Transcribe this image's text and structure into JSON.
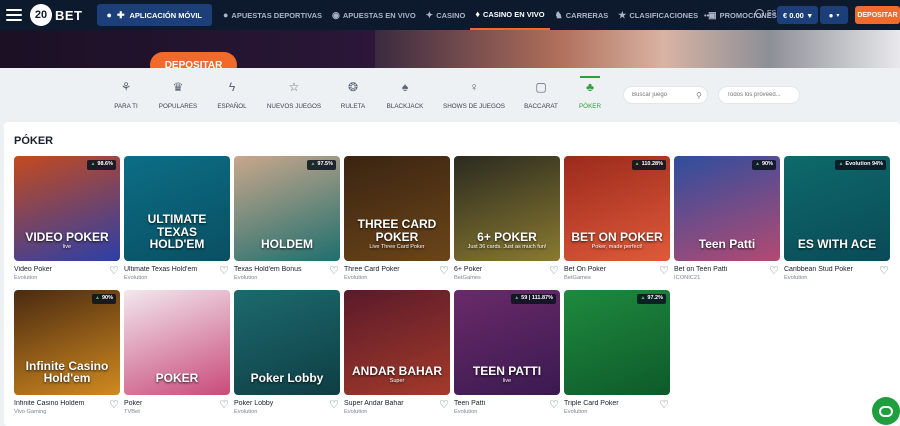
{
  "header": {
    "logo_number": "20",
    "logo_text": "BET",
    "app_button": "APLICACIÓN MÓVIL",
    "nav": [
      {
        "label": "APUESTAS DEPORTIVAS",
        "icon": "football-icon"
      },
      {
        "label": "APUESTAS EN VIVO",
        "icon": "live-icon"
      },
      {
        "label": "CASINO",
        "icon": "chip-icon"
      },
      {
        "label": "CASINO EN VIVO",
        "icon": "live-casino-icon",
        "active": true
      },
      {
        "label": "CARRERAS",
        "icon": "horse-icon"
      },
      {
        "label": "CLASIFICACIONES",
        "icon": "trophy-icon"
      },
      {
        "label": "PROMOCIONES",
        "icon": "gift-icon"
      }
    ],
    "more": "•••",
    "language": "ES",
    "balance": "€ 0.00",
    "deposit_button": "DEPOSITAR"
  },
  "banner": {
    "deposit_button": "DEPOSITAR"
  },
  "categories": [
    {
      "label": "PARA TI",
      "icon": "star-person-icon"
    },
    {
      "label": "POPULARES",
      "icon": "crown-icon"
    },
    {
      "label": "ESPAÑOL",
      "icon": "lightning-icon"
    },
    {
      "label": "NUEVOS JUEGOS",
      "icon": "star-icon"
    },
    {
      "label": "RULETA",
      "icon": "roulette-icon"
    },
    {
      "label": "BLACKJACK",
      "icon": "cards-icon"
    },
    {
      "label": "SHOWS DE JUEGOS",
      "icon": "microphone-icon"
    },
    {
      "label": "BACCARAT",
      "icon": "card-icon"
    },
    {
      "label": "PÓKER",
      "icon": "poker-icon",
      "active": true
    }
  ],
  "search": {
    "placeholder": "Buscar juego",
    "provider_placeholder": "Todos los proveed..."
  },
  "section": {
    "title": "PÓKER"
  },
  "games": [
    {
      "name": "Video Poker",
      "provider": "Evolution",
      "badge": "98.6%",
      "art_title": "VIDEO POKER",
      "art_sub": "live",
      "colors": [
        "#c44a1e",
        "#2b3fa8"
      ]
    },
    {
      "name": "Ultimate Texas Hold'em",
      "provider": "Evolution",
      "badge": "",
      "art_title": "ULTIMATE TEXAS HOLD'EM",
      "art_sub": "",
      "colors": [
        "#0b6e86",
        "#0a4f62"
      ]
    },
    {
      "name": "Texas Hold'em Bonus",
      "provider": "Evolution",
      "badge": "97.5%",
      "art_title": "HOLDEM",
      "art_sub": "",
      "colors": [
        "#c9a78c",
        "#1f6f6e"
      ]
    },
    {
      "name": "Three Card Poker",
      "provider": "Evolution",
      "badge": "",
      "art_title": "THREE CARD POKER",
      "art_sub": "Live Three Card Poker",
      "colors": [
        "#3a2412",
        "#6b4518"
      ]
    },
    {
      "name": "6+ Poker",
      "provider": "BetGames",
      "badge": "",
      "art_title": "6+ POKER",
      "art_sub": "Just 36 cards. Just as much fun!",
      "colors": [
        "#2a2a20",
        "#8a7a30"
      ]
    },
    {
      "name": "Bet On Poker",
      "provider": "BetGames",
      "badge": "110.28%",
      "art_title": "BET ON POKER",
      "art_sub": "Poker, made perfect!",
      "colors": [
        "#9b2a1c",
        "#e05a3a"
      ]
    },
    {
      "name": "Bet on Teen Patti",
      "provider": "ICONIC21",
      "badge": "90%",
      "art_title": "Teen Patti",
      "art_sub": "",
      "colors": [
        "#2e4e9e",
        "#b34a72"
      ]
    },
    {
      "name": "Caribbean Stud Poker",
      "provider": "Evolution",
      "badge": "Evolution 94%",
      "art_title": "ES WITH ACE",
      "art_sub": "",
      "colors": [
        "#0d6a6a",
        "#0a4a58"
      ]
    },
    {
      "name": "Infinite Casino Holdem",
      "provider": "Vivo Gaming",
      "badge": "90%",
      "art_title": "Infinite Casino Hold'em",
      "art_sub": "",
      "colors": [
        "#4a2a10",
        "#d08a20"
      ]
    },
    {
      "name": "Poker",
      "provider": "TVBet",
      "badge": "",
      "art_title": "POKER",
      "art_sub": "",
      "colors": [
        "#f2e8ee",
        "#c94a7a"
      ]
    },
    {
      "name": "Poker Lobby",
      "provider": "Evolution",
      "badge": "",
      "art_title": "Poker Lobby",
      "art_sub": "",
      "colors": [
        "#1c6a6e",
        "#0e3e44"
      ]
    },
    {
      "name": "Super Andar Bahar",
      "provider": "Evolution",
      "badge": "",
      "art_title": "ANDAR BAHAR",
      "art_sub": "Super",
      "colors": [
        "#5a1a2a",
        "#a33a2a"
      ]
    },
    {
      "name": "Teen Patti",
      "provider": "Evolution",
      "badge": "59 | 111.87%",
      "art_title": "TEEN PATTI",
      "art_sub": "live",
      "colors": [
        "#6a2a6a",
        "#3a1a50"
      ]
    },
    {
      "name": "Triple Card Poker",
      "provider": "Evolution",
      "badge": "97.2%",
      "art_title": "",
      "art_sub": "",
      "colors": [
        "#1e8a3e",
        "#0e5a2a"
      ]
    }
  ]
}
